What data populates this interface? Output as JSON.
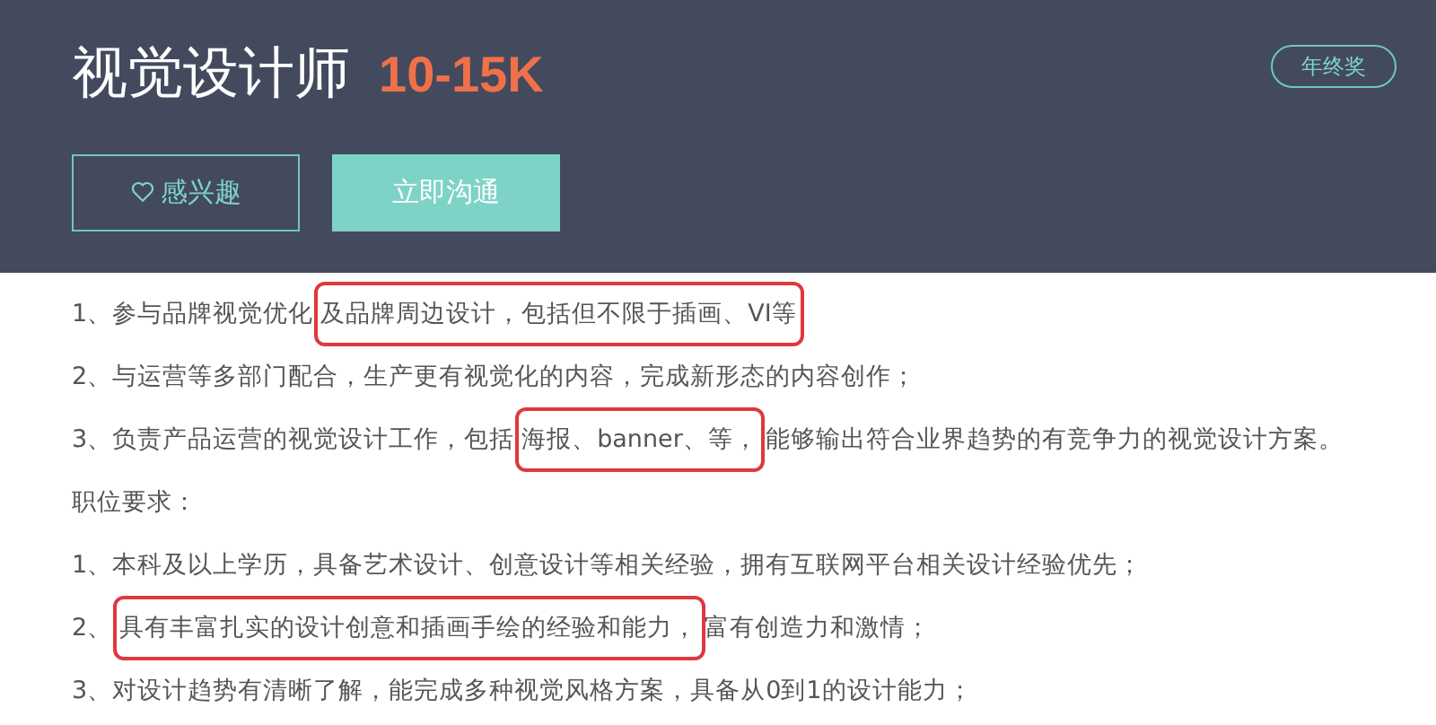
{
  "header": {
    "title": "视觉设计师",
    "salary": "10-15K",
    "badge": "年终奖",
    "buttons": [
      {
        "kind": "outline",
        "label": "感兴趣"
      },
      {
        "kind": "filled",
        "label": "立即沟通"
      }
    ]
  },
  "lines": [
    {
      "segments": [
        {
          "text": "1、参与品牌视觉优化",
          "highlighted": false
        },
        {
          "text": "及品牌周边设计，包括但不限于插画、VI等",
          "highlighted": true
        }
      ]
    },
    {
      "segments": [
        {
          "text": "2、与运营等多部门配合，生产更有视觉化的内容，完成新形态的内容创作；",
          "highlighted": false
        }
      ]
    },
    {
      "segments": [
        {
          "text": "3、负责产品运营的视觉设计工作，包括",
          "highlighted": false
        },
        {
          "text": "海报、banner、等，",
          "highlighted": true
        },
        {
          "text": "能够输出符合业界趋势的有竞争力的视觉设计方案。",
          "highlighted": false
        }
      ]
    },
    {
      "segments": [
        {
          "text": "职位要求：",
          "highlighted": false
        }
      ]
    },
    {
      "segments": [
        {
          "text": "1、本科及以上学历，具备艺术设计、创意设计等相关经验，拥有互联网平台相关设计经验优先；",
          "highlighted": false
        }
      ]
    },
    {
      "segments": [
        {
          "text": "2、",
          "highlighted": false
        },
        {
          "text": "具有丰富扎实的设计创意和插画手绘的经验和能力，",
          "highlighted": true
        },
        {
          "text": "富有创造力和激情；",
          "highlighted": false
        }
      ]
    },
    {
      "segments": [
        {
          "text": "3、对设计趋势有清晰了解，能完成多种视觉风格方案，具备从0到1的设计能力；",
          "highlighted": false
        }
      ]
    }
  ]
}
